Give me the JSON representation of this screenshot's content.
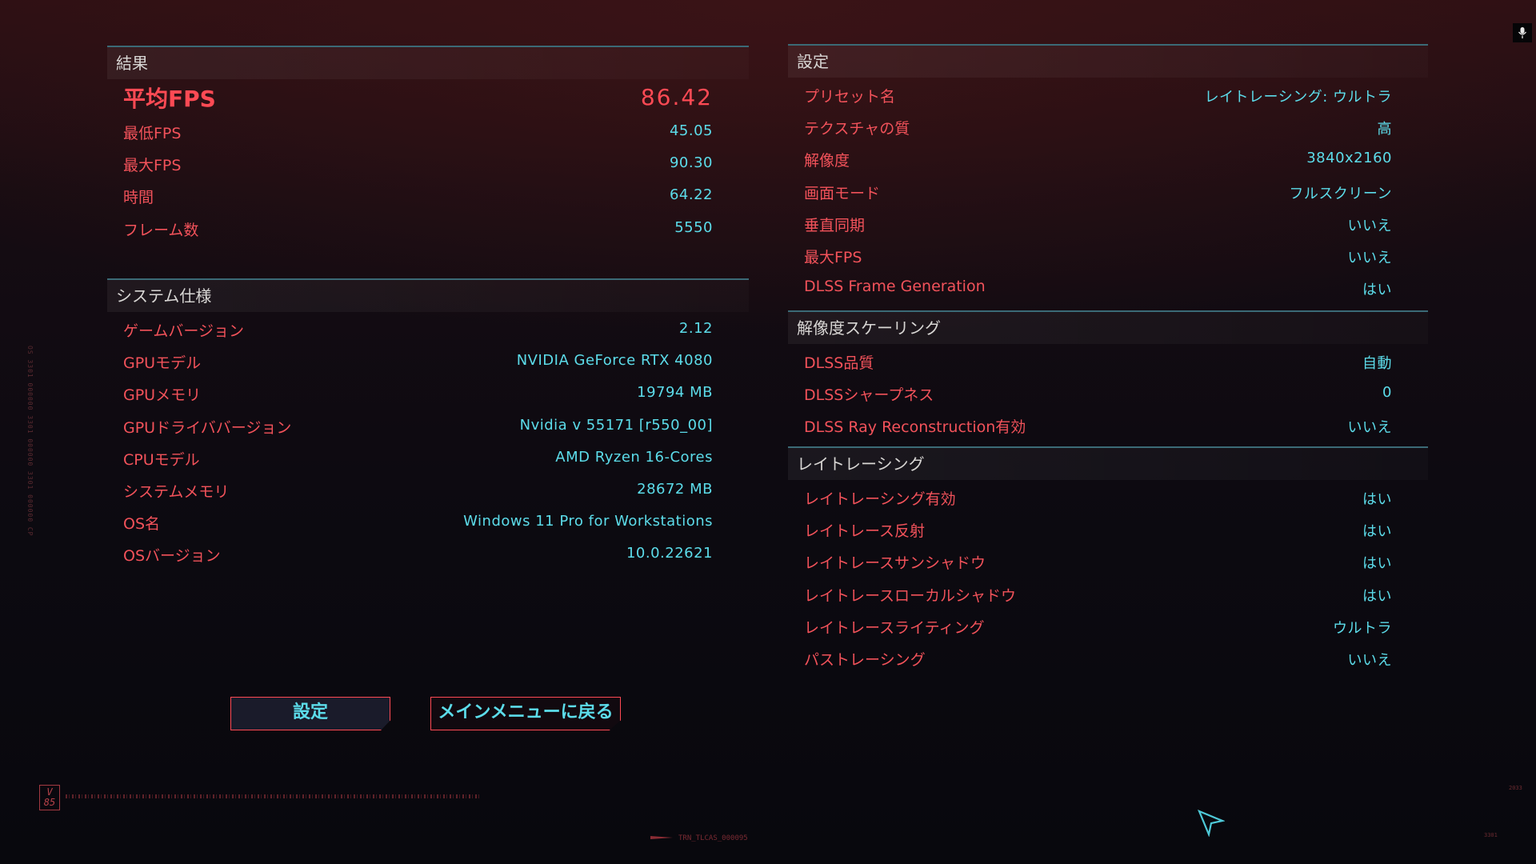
{
  "results": {
    "title": "結果",
    "avg_fps": {
      "label": "平均FPS",
      "value": "86.42"
    },
    "rows": [
      {
        "label": "最低FPS",
        "value": "45.05"
      },
      {
        "label": "最大FPS",
        "value": "90.30"
      },
      {
        "label": "時間",
        "value": "64.22"
      },
      {
        "label": "フレーム数",
        "value": "5550"
      }
    ]
  },
  "system": {
    "title": "システム仕様",
    "rows": [
      {
        "label": "ゲームバージョン",
        "value": "2.12"
      },
      {
        "label": "GPUモデル",
        "value": "NVIDIA GeForce RTX 4080"
      },
      {
        "label": "GPUメモリ",
        "value": "19794 MB"
      },
      {
        "label": "GPUドライババージョン",
        "value": "Nvidia v 55171 [r550_00]"
      },
      {
        "label": "CPUモデル",
        "value": "AMD Ryzen 16-Cores"
      },
      {
        "label": "システムメモリ",
        "value": "28672 MB"
      },
      {
        "label": "OS名",
        "value": "Windows 11 Pro for Workstations"
      },
      {
        "label": "OSバージョン",
        "value": "10.0.22621"
      }
    ]
  },
  "settings": {
    "title": "設定",
    "rows": [
      {
        "label": "プリセット名",
        "value": "レイトレーシング: ウルトラ"
      },
      {
        "label": "テクスチャの質",
        "value": "高"
      },
      {
        "label": "解像度",
        "value": "3840x2160"
      },
      {
        "label": "画面モード",
        "value": "フルスクリーン"
      },
      {
        "label": "垂直同期",
        "value": "いいえ"
      },
      {
        "label": "最大FPS",
        "value": "いいえ"
      },
      {
        "label": "DLSS Frame Generation",
        "value": "はい"
      }
    ]
  },
  "scaling": {
    "title": "解像度スケーリング",
    "rows": [
      {
        "label": "DLSS品質",
        "value": "自動"
      },
      {
        "label": "DLSSシャープネス",
        "value": "0"
      },
      {
        "label": "DLSS Ray Reconstruction有効",
        "value": "いいえ"
      }
    ]
  },
  "raytracing": {
    "title": "レイトレーシング",
    "rows": [
      {
        "label": "レイトレーシング有効",
        "value": "はい"
      },
      {
        "label": "レイトレース反射",
        "value": "はい"
      },
      {
        "label": "レイトレースサンシャドウ",
        "value": "はい"
      },
      {
        "label": "レイトレースローカルシャドウ",
        "value": "はい"
      },
      {
        "label": "レイトレースライティング",
        "value": "ウルトラ"
      },
      {
        "label": "パストレーシング",
        "value": "いいえ"
      }
    ]
  },
  "buttons": {
    "settings": "設定",
    "main_menu": "メインメニューに戻る"
  },
  "decor": {
    "badge": "V\n85",
    "side_code": "OS 3301 000000 3301 000000 3301 000000 CP",
    "bottom_code": "TRN_TLCAS_000095",
    "corner_code_right_top": "2033",
    "corner_code_right_bottom": "3301"
  },
  "colors": {
    "label_red": "#f2525a",
    "value_cyan": "#5cdcea",
    "header_line": "#3b6a76"
  },
  "icons": {
    "mic": "microphone-icon",
    "cursor": "arrow-cursor-icon"
  }
}
